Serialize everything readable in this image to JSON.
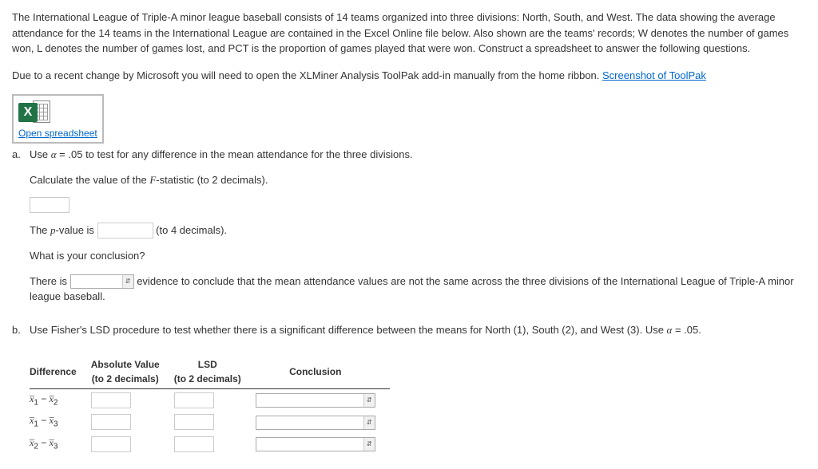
{
  "intro": {
    "p1": "The International League of Triple-A minor league baseball consists of 14 teams organized into three divisions: North, South, and West. The data showing the average attendance for the 14 teams in the International League are contained in the Excel Online file below. Also shown are the teams' records; W denotes the number of games won, L denotes the number of games lost, and PCT is the proportion of games played that were won. Construct a spreadsheet to answer the following questions.",
    "p2_pre": "Due to a recent change by Microsoft you will need to open the XLMiner Analysis ToolPak add-in manually from the home ribbon. ",
    "p2_link": "Screenshot of ToolPak"
  },
  "excel": {
    "x": "X",
    "open": "Open spreadsheet"
  },
  "qa": {
    "label": "a.",
    "line1_pre": "Use ",
    "line1_alpha": "α",
    "line1_eq": " = .05",
    "line1_post": " to test for any difference in the mean attendance for the three divisions.",
    "line2_pre": "Calculate the value of the ",
    "line2_F": "F",
    "line2_post": "-statistic (to 2 decimals).",
    "pval_pre": "The ",
    "pval_p": "p",
    "pval_mid": "-value is ",
    "pval_post": " (to 4 decimals).",
    "conc_q": "What is your conclusion?",
    "conc_pre": "There is ",
    "conc_post": " evidence to conclude that the mean attendance values are not the same across the three divisions of the International League of Triple-A minor league baseball."
  },
  "qb": {
    "label": "b.",
    "text_pre": "Use Fisher's LSD procedure to test whether there is a significant difference between the means for North (1), South (2), and West (3). Use ",
    "text_alpha": "α",
    "text_eq": " = .05.",
    "headers": {
      "diff": "Difference",
      "abs1": "Absolute Value",
      "abs2": "(to 2 decimals)",
      "lsd1": "LSD",
      "lsd2": "(to 2 decimals)",
      "conc": "Conclusion"
    },
    "rows": [
      {
        "a": "1",
        "b": "2"
      },
      {
        "a": "1",
        "b": "3"
      },
      {
        "a": "2",
        "b": "3"
      }
    ]
  }
}
